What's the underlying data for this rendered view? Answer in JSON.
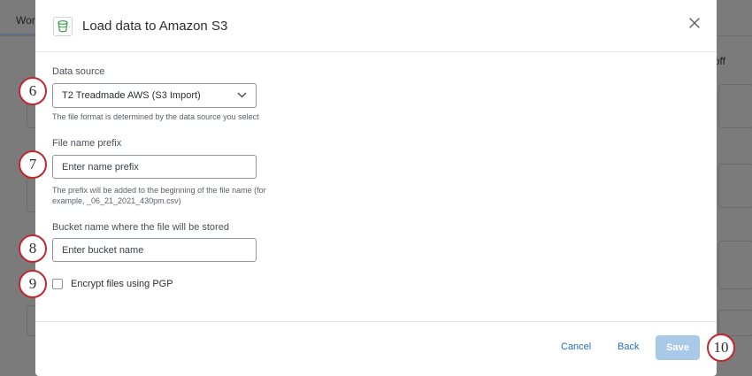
{
  "background": {
    "tab_label": "Work",
    "right_text": "off"
  },
  "modal": {
    "title": "Load data to Amazon S3",
    "icon": "bucket-icon",
    "data_source": {
      "label": "Data source",
      "selected": "T2 Treadmade AWS (S3 Import)",
      "help": "The file format is determined by the data source you select"
    },
    "file_prefix": {
      "label": "File name prefix",
      "placeholder": "Enter name prefix",
      "help_line1": "The prefix will be added to the beginning of the file name (for",
      "help_line2": "example, _06_21_2021_430pm.csv)"
    },
    "bucket": {
      "label": "Bucket name where the file will be stored",
      "placeholder": "Enter bucket name"
    },
    "encrypt": {
      "label": "Encrypt files using PGP",
      "checked": false
    },
    "footer": {
      "cancel": "Cancel",
      "back": "Back",
      "save": "Save"
    }
  },
  "badges": [
    "6",
    "7",
    "8",
    "9",
    "10"
  ],
  "colors": {
    "accent": "#1f6fb5",
    "badge_border": "#c1272d",
    "save_disabled": "#a9c9e8"
  }
}
